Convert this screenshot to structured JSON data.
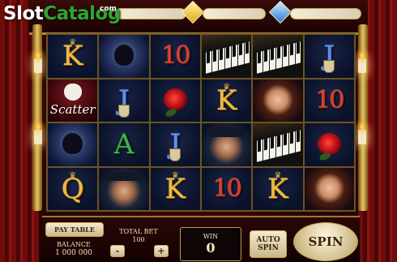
{
  "logo": {
    "part1": "Slot",
    "part2": "Catalog",
    "suffix": "com"
  },
  "header": {
    "meter_left_gem": "yellow-diamond-icon",
    "meter_right_gem": "blue-diamond-icon"
  },
  "reels": [
    [
      {
        "type": "letter",
        "text": "K",
        "color": "gold"
      },
      {
        "type": "scatter",
        "text": "Scatter"
      },
      {
        "type": "image",
        "icon": "masked-phantom-icon"
      },
      {
        "type": "letter",
        "text": "Q",
        "color": "gold"
      }
    ],
    [
      {
        "type": "image",
        "icon": "masked-phantom-icon"
      },
      {
        "type": "letter",
        "text": "J",
        "color": "blue"
      },
      {
        "type": "letter",
        "text": "A",
        "color": "green"
      },
      {
        "type": "image",
        "icon": "masked-man-icon"
      }
    ],
    [
      {
        "type": "ten",
        "text": "10",
        "color": "red"
      },
      {
        "type": "image",
        "icon": "red-rose-icon"
      },
      {
        "type": "letter",
        "text": "J",
        "color": "blue"
      },
      {
        "type": "letter",
        "text": "K",
        "color": "gold"
      }
    ],
    [
      {
        "type": "image",
        "icon": "piano-keys-icon"
      },
      {
        "type": "letter",
        "text": "K",
        "color": "gold"
      },
      {
        "type": "image",
        "icon": "masked-man-icon"
      },
      {
        "type": "ten",
        "text": "10",
        "color": "red"
      }
    ],
    [
      {
        "type": "image",
        "icon": "piano-keys-icon"
      },
      {
        "type": "image",
        "icon": "woman-portrait-icon"
      },
      {
        "type": "image",
        "icon": "piano-keys-icon"
      },
      {
        "type": "letter",
        "text": "K",
        "color": "gold"
      }
    ],
    [
      {
        "type": "letter",
        "text": "J",
        "color": "blue"
      },
      {
        "type": "ten",
        "text": "10",
        "color": "red"
      },
      {
        "type": "image",
        "icon": "red-rose-icon"
      },
      {
        "type": "image",
        "icon": "woman-portrait-icon"
      }
    ]
  ],
  "controls": {
    "pay_table": "PAY TABLE",
    "balance_label": "BALANCE",
    "balance_value": "1 000 000",
    "total_bet_label": "TOTAL BET",
    "total_bet_value": "100",
    "minus": "-",
    "plus": "+",
    "win_label": "WIN",
    "win_value": "0",
    "auto_spin_line1": "AUTO",
    "auto_spin_line2": "SPIN",
    "spin": "SPIN"
  }
}
